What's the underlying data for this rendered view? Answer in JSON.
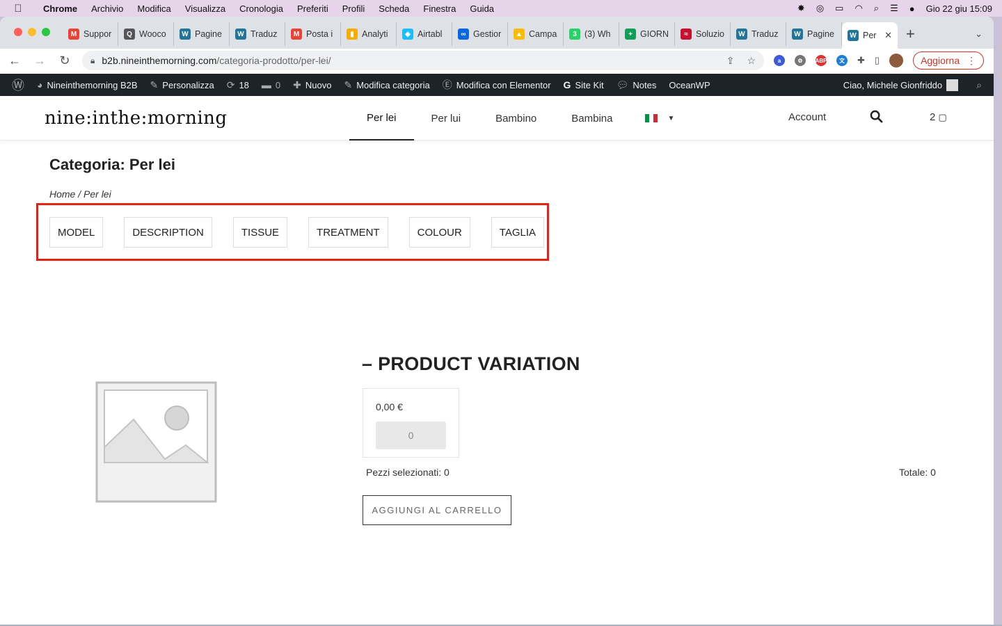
{
  "menubar": {
    "app": "Chrome",
    "items": [
      "Archivio",
      "Modifica",
      "Visualizza",
      "Cronologia",
      "Preferiti",
      "Profili",
      "Scheda",
      "Finestra",
      "Guida"
    ],
    "datetime": "Gio 22 giu  15:09"
  },
  "browser": {
    "tabs": [
      {
        "label": "Suppor",
        "icon": "gmail-icon",
        "color": "#ea4335",
        "glyph": "M"
      },
      {
        "label": "Wooco",
        "icon": "woo-icon",
        "color": "#555555",
        "glyph": "Q"
      },
      {
        "label": "Pagine",
        "icon": "wordpress-icon",
        "color": "#21759b",
        "glyph": "W"
      },
      {
        "label": "Traduz",
        "icon": "wordpress-icon",
        "color": "#21759b",
        "glyph": "W"
      },
      {
        "label": "Posta i",
        "icon": "gmail-icon",
        "color": "#ea4335",
        "glyph": "M"
      },
      {
        "label": "Analyti",
        "icon": "analytics-icon",
        "color": "#f9ab00",
        "glyph": "▮"
      },
      {
        "label": "Airtabl",
        "icon": "airtable-icon",
        "color": "#18bfff",
        "glyph": "◆"
      },
      {
        "label": "Gestior",
        "icon": "meta-icon",
        "color": "#0668e1",
        "glyph": "∞"
      },
      {
        "label": "Campa",
        "icon": "google-ads-icon",
        "color": "#fbbc04",
        "glyph": "▲"
      },
      {
        "label": "(3) Wh",
        "icon": "whatsapp-icon",
        "color": "#25d366",
        "glyph": "3"
      },
      {
        "label": "GIORN",
        "icon": "sheets-icon",
        "color": "#0f9d58",
        "glyph": "+"
      },
      {
        "label": "Soluzio",
        "icon": "trenitalia-icon",
        "color": "#c8102e",
        "glyph": "≈"
      },
      {
        "label": "Traduz",
        "icon": "wordpress-icon",
        "color": "#21759b",
        "glyph": "W"
      },
      {
        "label": "Pagine",
        "icon": "wordpress-icon",
        "color": "#21759b",
        "glyph": "W"
      }
    ],
    "active_tab": {
      "label": "Per",
      "icon": "wordpress-icon",
      "color": "#21759b",
      "glyph": "W"
    },
    "url_domain": "b2b.nineinthemorning.com",
    "url_path": "/categoria-prodotto/per-lei/",
    "update_label": "Aggiorna"
  },
  "wpbar": {
    "site_name": "Nineinthemorning B2B",
    "customize": "Personalizza",
    "updates_count": "18",
    "comments_count": "0",
    "new": "Nuovo",
    "edit_category": "Modifica categoria",
    "elementor": "Modifica con Elementor",
    "sitekit": "Site Kit",
    "notes": "Notes",
    "oceanwp": "OceanWP",
    "greeting": "Ciao, Michele Gionfriddo"
  },
  "site": {
    "logo": "nine:inthe:morning",
    "nav": [
      "Per lei",
      "Per lui",
      "Bambino",
      "Bambina"
    ],
    "active_nav": "Per lei",
    "account": "Account",
    "cart_count": "2"
  },
  "content": {
    "title": "Categoria: Per lei",
    "breadcrumb": "Home / Per lei",
    "filters": [
      "MODEL",
      "DESCRIPTION",
      "TISSUE",
      "TREATMENT",
      "COLOUR",
      "TAGLIA"
    ],
    "product_title": "– PRODUCT VARIATION",
    "price": "0,00 €",
    "quantity": "0",
    "pieces_selected": "Pezzi selezionati: 0",
    "total": "Totale: 0",
    "add_to_cart": "AGGIUNGI AL CARRELLO"
  },
  "colors": {
    "highlight": "#e8201a",
    "wpbar_bg": "#1d2327",
    "tabstrip_bg": "#dee1e6"
  }
}
